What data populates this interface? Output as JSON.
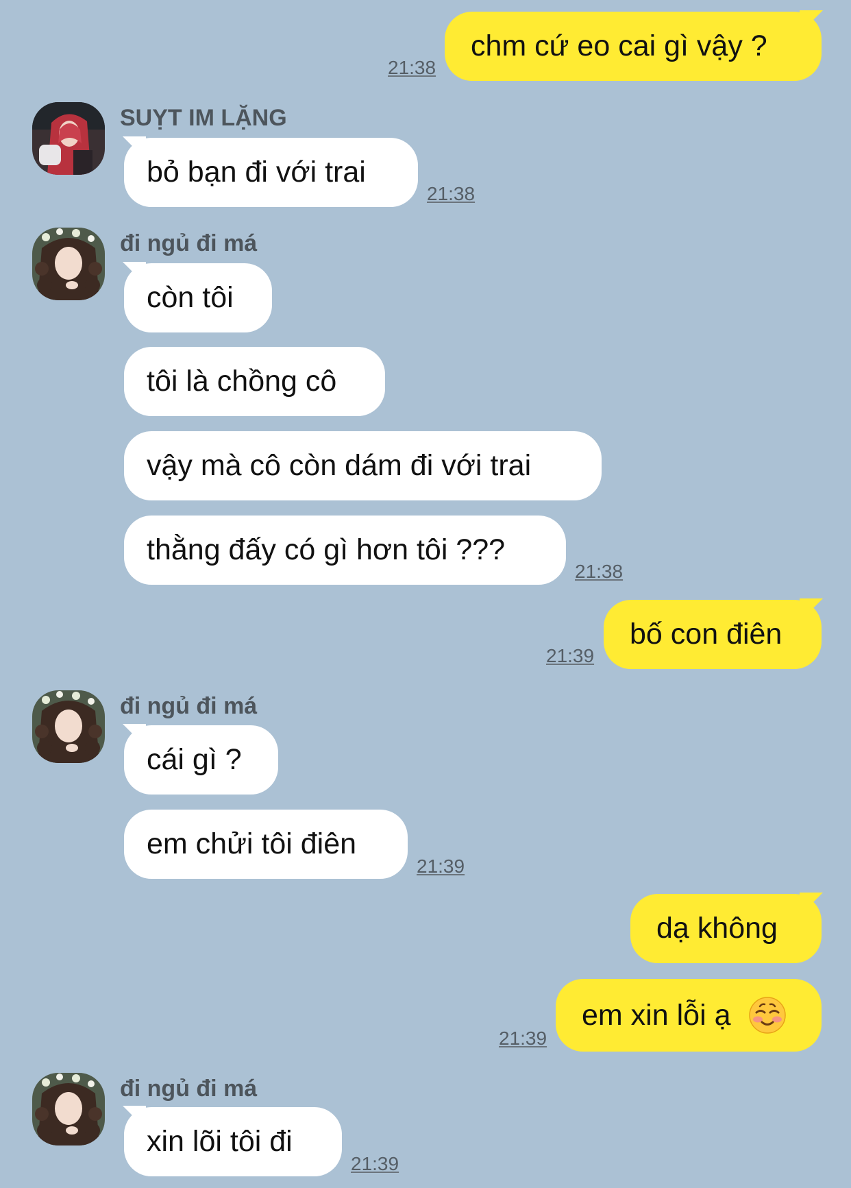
{
  "colors": {
    "background": "#abc1d4",
    "incoming_bubble": "#ffffff",
    "outgoing_bubble": "#ffeb33",
    "timestamp": "#555e66",
    "sender_name": "#4d555c"
  },
  "messages": [
    {
      "dir": "out",
      "text": "chm cứ eo cai gì vậy ?",
      "time": "21:38"
    },
    {
      "dir": "in",
      "sender": "SUỴT IM LẶNG",
      "avatar": "avatar-red-hair",
      "text": "bỏ bạn đi với trai",
      "time": "21:38"
    },
    {
      "dir": "in",
      "sender": "đi ngủ đi má",
      "avatar": "avatar-curly-hair",
      "text": "còn tôi"
    },
    {
      "dir": "in",
      "text": "tôi là chồng cô"
    },
    {
      "dir": "in",
      "text": "vậy mà cô còn dám đi với trai"
    },
    {
      "dir": "in",
      "text": "thằng đấy có gì hơn tôi ???",
      "time": "21:38"
    },
    {
      "dir": "out",
      "text": "bố con điên",
      "time": "21:39"
    },
    {
      "dir": "in",
      "sender": "đi ngủ đi má",
      "avatar": "avatar-curly-hair",
      "text": "cái gì ?"
    },
    {
      "dir": "in",
      "text": "em chửi tôi điên",
      "time": "21:39"
    },
    {
      "dir": "out",
      "text": "dạ không"
    },
    {
      "dir": "out",
      "text": "em xin lỗi ạ",
      "emoji": "smiling-blush-emoji",
      "time": "21:39"
    },
    {
      "dir": "in",
      "sender": "đi ngủ đi má",
      "avatar": "avatar-curly-hair",
      "text": "xin lõi tôi đi",
      "time": "21:39"
    }
  ]
}
